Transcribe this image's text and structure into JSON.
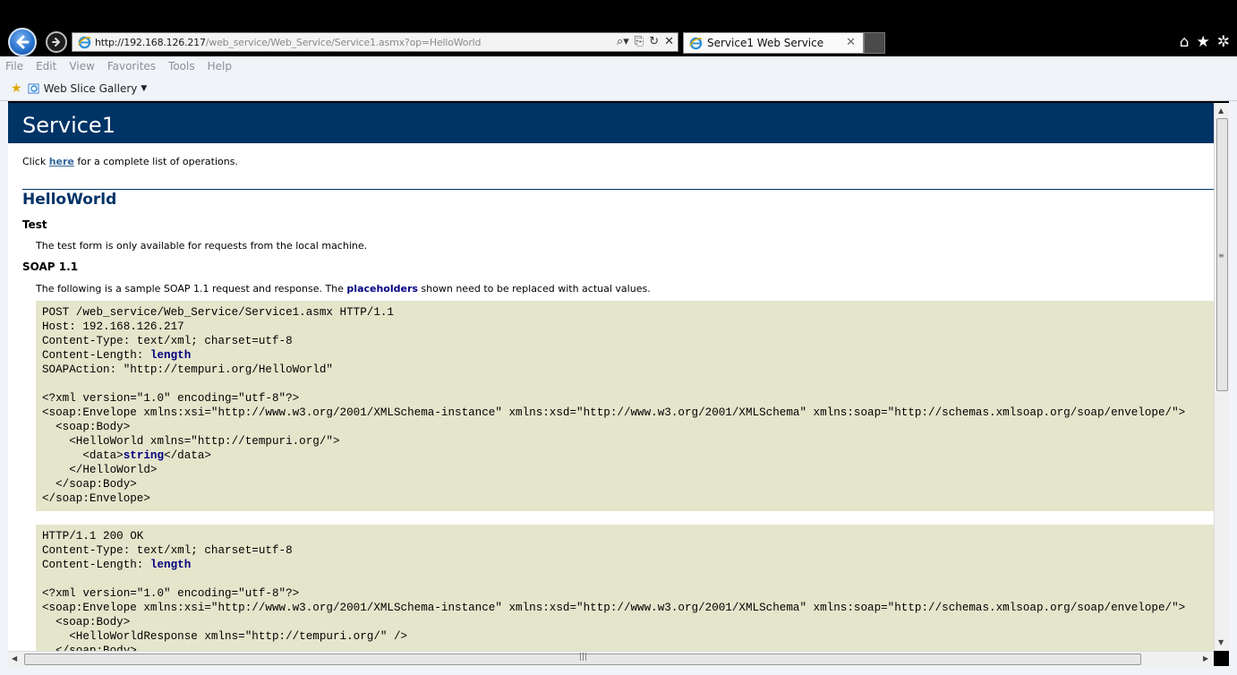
{
  "browser": {
    "url_host": "http://192.168.126.217",
    "url_path": "/web_service/Web_Service/Service1.asmx?op=HelloWorld",
    "tab_title": "Service1 Web Service",
    "menu": [
      "File",
      "Edit",
      "View",
      "Favorites",
      "Tools",
      "Help"
    ],
    "favorites_bar": {
      "web_slice_label": "Web Slice Gallery"
    }
  },
  "page": {
    "service_name": "Service1",
    "intro": {
      "before": "Click ",
      "link": "here",
      "after": " for a complete list of operations."
    },
    "operation": "HelloWorld",
    "test_heading": "Test",
    "test_text": "The test form is only available for requests from the local machine.",
    "soap_heading": "SOAP 1.1",
    "soap_text": {
      "before": "The following is a sample SOAP 1.1 request and response. The ",
      "highlight": "placeholders",
      "after": " shown need to be replaced with actual values."
    },
    "request_lines": [
      [
        "POST /web_service/Web_Service/Service1.asmx HTTP/1.1"
      ],
      [
        "Host: 192.168.126.217"
      ],
      [
        "Content-Type: text/xml; charset=utf-8"
      ],
      [
        "Content-Length: ",
        {
          "ph": "length"
        }
      ],
      [
        "SOAPAction: \"http://tempuri.org/HelloWorld\""
      ],
      [
        ""
      ],
      [
        "<?xml version=\"1.0\" encoding=\"utf-8\"?>"
      ],
      [
        "<soap:Envelope xmlns:xsi=\"http://www.w3.org/2001/XMLSchema-instance\" xmlns:xsd=\"http://www.w3.org/2001/XMLSchema\" xmlns:soap=\"http://schemas.xmlsoap.org/soap/envelope/\">"
      ],
      [
        "  <soap:Body>"
      ],
      [
        "    <HelloWorld xmlns=\"http://tempuri.org/\">"
      ],
      [
        "      <data>",
        {
          "ph": "string"
        },
        "</data>"
      ],
      [
        "    </HelloWorld>"
      ],
      [
        "  </soap:Body>"
      ],
      [
        "</soap:Envelope>"
      ]
    ],
    "response_lines": [
      [
        "HTTP/1.1 200 OK"
      ],
      [
        "Content-Type: text/xml; charset=utf-8"
      ],
      [
        "Content-Length: ",
        {
          "ph": "length"
        }
      ],
      [
        ""
      ],
      [
        "<?xml version=\"1.0\" encoding=\"utf-8\"?>"
      ],
      [
        "<soap:Envelope xmlns:xsi=\"http://www.w3.org/2001/XMLSchema-instance\" xmlns:xsd=\"http://www.w3.org/2001/XMLSchema\" xmlns:soap=\"http://schemas.xmlsoap.org/soap/envelope/\">"
      ],
      [
        "  <soap:Body>"
      ],
      [
        "    <HelloWorldResponse xmlns=\"http://tempuri.org/\" />"
      ],
      [
        "  </soap:Body>"
      ]
    ]
  },
  "colors": {
    "banner": "#003366",
    "code_background": "#e5e5cc",
    "placeholder": "#000080",
    "link": "#336699"
  }
}
